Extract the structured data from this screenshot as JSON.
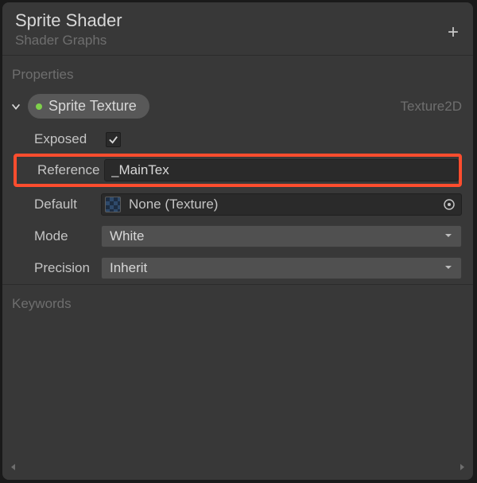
{
  "header": {
    "title": "Sprite Shader",
    "subtitle": "Shader Graphs"
  },
  "sections": {
    "properties_label": "Properties",
    "keywords_label": "Keywords"
  },
  "property": {
    "name": "Sprite Texture",
    "type": "Texture2D"
  },
  "fields": {
    "exposed_label": "Exposed",
    "exposed_checked": true,
    "reference_label": "Reference",
    "reference_value": "_MainTex",
    "default_label": "Default",
    "default_value": "None (Texture)",
    "mode_label": "Mode",
    "mode_value": "White",
    "precision_label": "Precision",
    "precision_value": "Inherit"
  }
}
